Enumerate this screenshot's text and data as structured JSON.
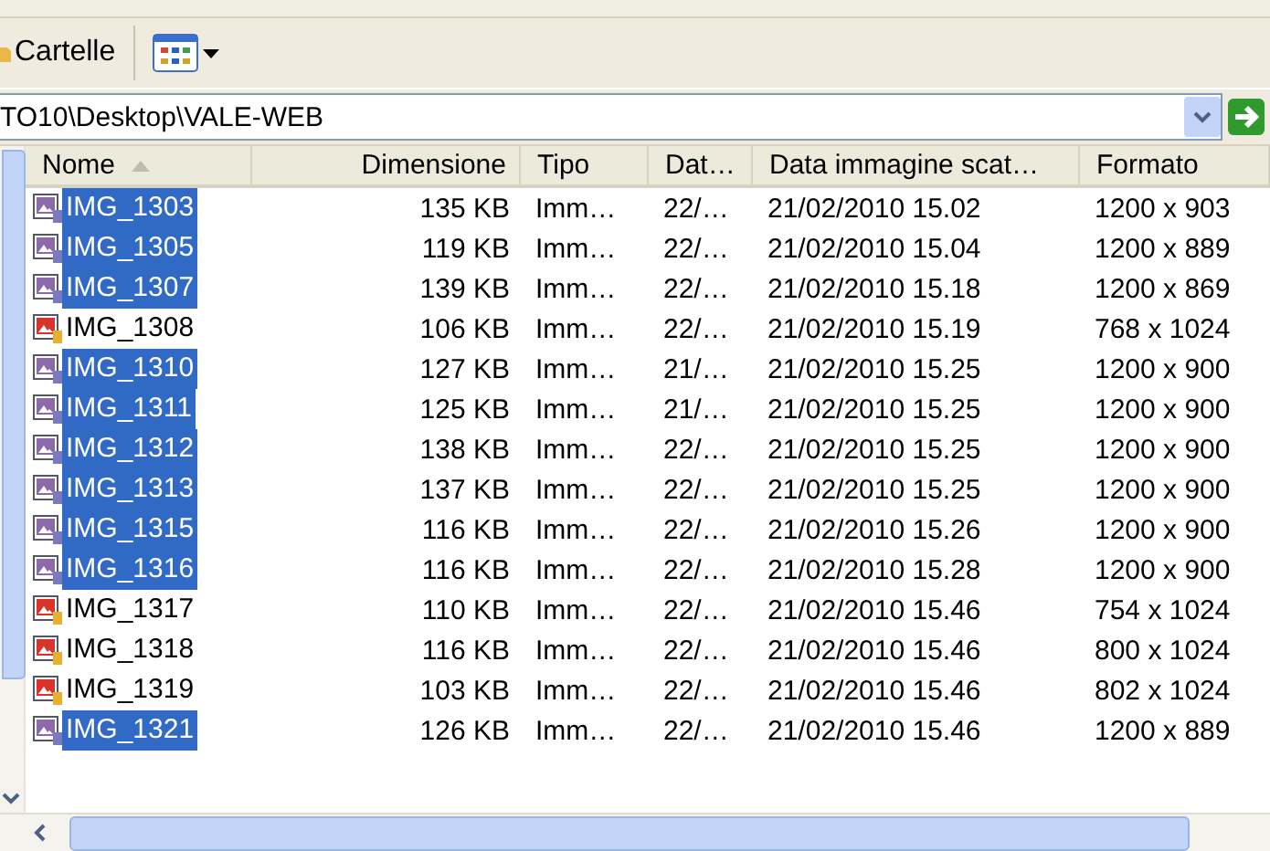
{
  "toolbar": {
    "folders_label": "Cartelle"
  },
  "address": {
    "value": "TO10\\Desktop\\VALE-WEB"
  },
  "columns": [
    {
      "label": "Nome",
      "sorted": true
    },
    {
      "label": "Dimensione",
      "sorted": false
    },
    {
      "label": "Tipo",
      "sorted": false
    },
    {
      "label": "Dat…",
      "sorted": false
    },
    {
      "label": "Data immagine scat…",
      "sorted": false
    },
    {
      "label": "Formato",
      "sorted": false
    }
  ],
  "rows": [
    {
      "name": "IMG_1303",
      "size": "135 KB",
      "type": "Imm…",
      "date": "22/…",
      "taken": "21/02/2010 15.02",
      "format": "1200 x 903",
      "selected": true
    },
    {
      "name": "IMG_1305",
      "size": "119 KB",
      "type": "Imm…",
      "date": "22/…",
      "taken": "21/02/2010 15.04",
      "format": "1200 x 889",
      "selected": true
    },
    {
      "name": "IMG_1307",
      "size": "139 KB",
      "type": "Imm…",
      "date": "22/…",
      "taken": "21/02/2010 15.18",
      "format": "1200 x 869",
      "selected": true
    },
    {
      "name": "IMG_1308",
      "size": "106 KB",
      "type": "Imm…",
      "date": "22/…",
      "taken": "21/02/2010 15.19",
      "format": "768 x 1024",
      "selected": false
    },
    {
      "name": "IMG_1310",
      "size": "127 KB",
      "type": "Imm…",
      "date": "21/…",
      "taken": "21/02/2010 15.25",
      "format": "1200 x 900",
      "selected": true
    },
    {
      "name": "IMG_1311",
      "size": "125 KB",
      "type": "Imm…",
      "date": "21/…",
      "taken": "21/02/2010 15.25",
      "format": "1200 x 900",
      "selected": true
    },
    {
      "name": "IMG_1312",
      "size": "138 KB",
      "type": "Imm…",
      "date": "22/…",
      "taken": "21/02/2010 15.25",
      "format": "1200 x 900",
      "selected": true
    },
    {
      "name": "IMG_1313",
      "size": "137 KB",
      "type": "Imm…",
      "date": "22/…",
      "taken": "21/02/2010 15.25",
      "format": "1200 x 900",
      "selected": true
    },
    {
      "name": "IMG_1315",
      "size": "116 KB",
      "type": "Imm…",
      "date": "22/…",
      "taken": "21/02/2010 15.26",
      "format": "1200 x 900",
      "selected": true
    },
    {
      "name": "IMG_1316",
      "size": "116 KB",
      "type": "Imm…",
      "date": "22/…",
      "taken": "21/02/2010 15.28",
      "format": "1200 x 900",
      "selected": true
    },
    {
      "name": "IMG_1317",
      "size": "110 KB",
      "type": "Imm…",
      "date": "22/…",
      "taken": "21/02/2010 15.46",
      "format": "754 x 1024",
      "selected": false
    },
    {
      "name": "IMG_1318",
      "size": "116 KB",
      "type": "Imm…",
      "date": "22/…",
      "taken": "21/02/2010 15.46",
      "format": "800 x 1024",
      "selected": false
    },
    {
      "name": "IMG_1319",
      "size": "103 KB",
      "type": "Imm…",
      "date": "22/…",
      "taken": "21/02/2010 15.46",
      "format": "802 x 1024",
      "selected": false
    },
    {
      "name": "IMG_1321",
      "size": "126 KB",
      "type": "Imm…",
      "date": "22/…",
      "taken": "21/02/2010 15.46",
      "format": "1200 x 889",
      "selected": true
    }
  ]
}
